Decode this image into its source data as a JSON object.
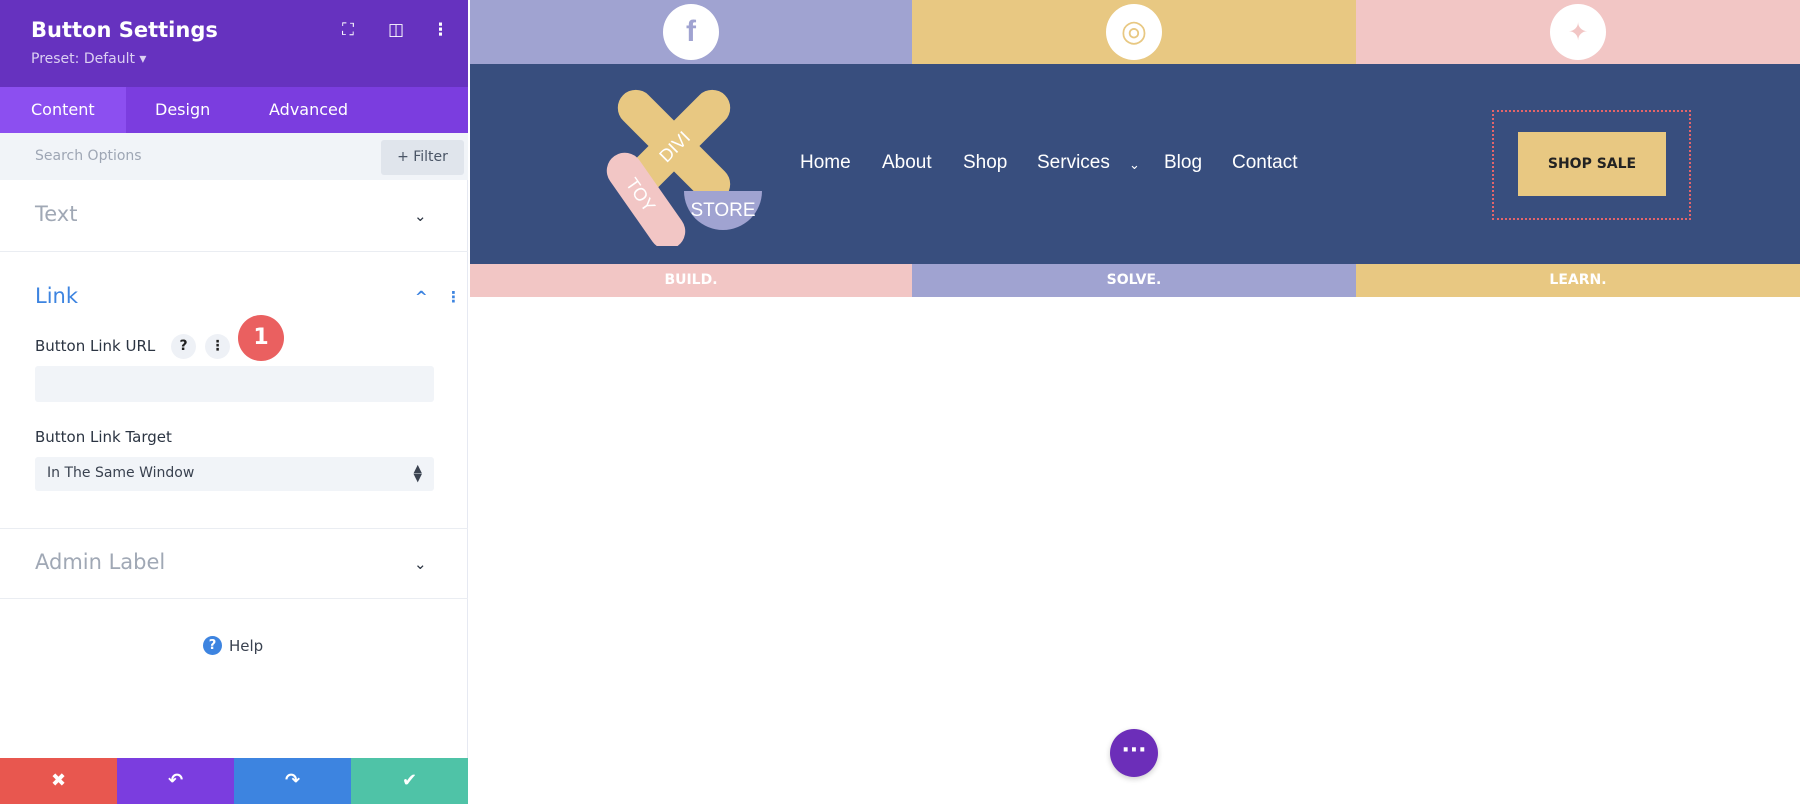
{
  "panel": {
    "title": "Button Settings",
    "preset": "Preset: Default ▾",
    "tabs": [
      {
        "label": "Content",
        "active": true
      },
      {
        "label": "Design"
      },
      {
        "label": "Advanced"
      }
    ],
    "search_placeholder": "Search Options",
    "filter_label": "+ Filter",
    "sections": {
      "text": "Text",
      "link": "Link",
      "admin": "Admin Label"
    },
    "link_url_label": "Button Link URL",
    "link_url_value": "",
    "help_q": "?",
    "link_target_label": "Button Link Target",
    "link_target_value": "In The Same Window",
    "help_label": "Help",
    "badge": "1",
    "colors": {
      "header": "#6632bf",
      "tabs": "#7b3ddf",
      "cancel": "#e8574f",
      "undo": "#7b3ddf",
      "redo": "#3d84e0",
      "save": "#4fc3a7"
    }
  },
  "site": {
    "social": [
      {
        "icon": "facebook-icon",
        "glyph": "f",
        "color": "#a0a3d1"
      },
      {
        "icon": "instagram-icon",
        "glyph": "◎",
        "color": "#e8c882"
      },
      {
        "icon": "twitter-icon",
        "glyph": "🐦",
        "color": "#f2c6c5"
      }
    ],
    "logo": {
      "words": [
        "DIVI",
        "TOY",
        "STORE"
      ]
    },
    "nav": [
      "Home",
      "About",
      "Shop",
      "Services",
      "Blog",
      "Contact"
    ],
    "cta": "SHOP SALE",
    "strip": [
      {
        "label": "BUILD.",
        "color": "#f2c6c5"
      },
      {
        "label": "SOLVE.",
        "color": "#a0a3d1"
      },
      {
        "label": "LEARN.",
        "color": "#e8c882"
      }
    ],
    "nav_bg": "#384e7e"
  }
}
